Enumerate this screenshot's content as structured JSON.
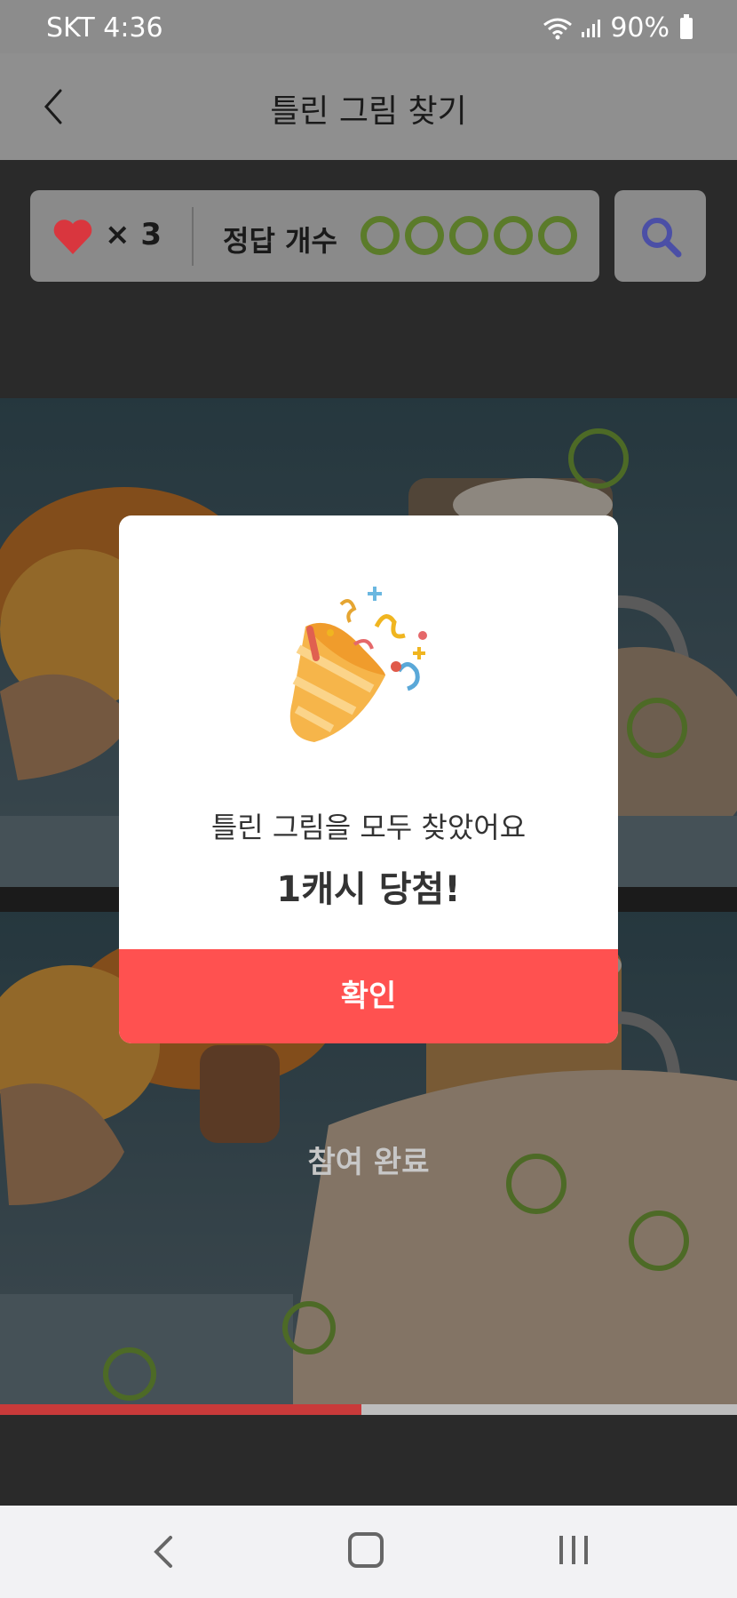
{
  "status_bar": {
    "carrier_time": "SKT 4:36",
    "battery": "90%"
  },
  "header": {
    "title": "틀린 그림 찾기",
    "back_icon": "chevron-left-icon"
  },
  "game_info": {
    "lives_text": "× 3",
    "lives": 3,
    "answer_label": "정답 개수",
    "answers_found": 5,
    "answers_total": 5,
    "circle_color": "#5b7b2a",
    "heart_color": "#d9363e",
    "search_icon": "search-icon"
  },
  "images": {
    "subject": "pumpkin latte",
    "participated_label": "참여 완료"
  },
  "progress": {
    "fraction": 0.49,
    "fill_color": "#c93a3a"
  },
  "modal": {
    "icon": "party-popper-icon",
    "message": "틀린 그림을 모두 찾았어요",
    "prize": "1캐시 당첨!",
    "confirm_label": "확인",
    "button_color": "#ff5150"
  },
  "nav_bar": {
    "back": "back-icon",
    "home": "home-icon",
    "recents": "recents-icon"
  }
}
